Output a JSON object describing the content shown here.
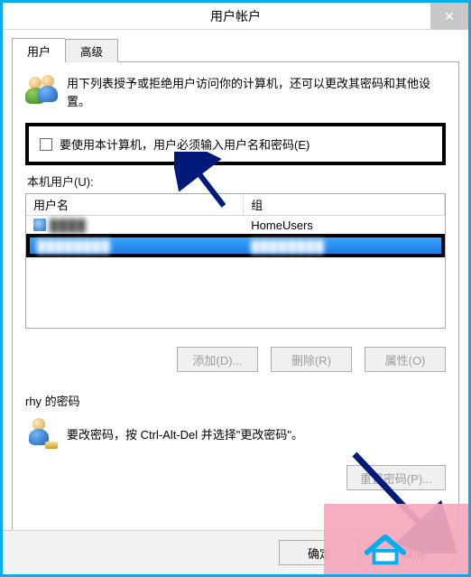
{
  "window": {
    "title": "用户帐户",
    "close_glyph": "✕"
  },
  "tabs": {
    "user": "用户",
    "advanced": "高级"
  },
  "intro": {
    "text": "用下列表授予或拒绝用户访问你的计算机，还可以更改其密码和其他设置。"
  },
  "checkbox": {
    "label": "要使用本计算机，用户必须输入用户名和密码(E)"
  },
  "users_group_label": "本机用户(U):",
  "userlist": {
    "col_user": "用户名",
    "col_group": "组",
    "rows": [
      {
        "user_masked": "████",
        "group": "HomeUsers"
      },
      {
        "user_masked": "████████",
        "group_masked": "████████"
      }
    ]
  },
  "buttons": {
    "add": "添加(D)...",
    "delete": "删除(R)",
    "properties": "属性(O)",
    "reset_pw": "重置密码(P)...",
    "ok": "确定",
    "cancel": "取消"
  },
  "password_section": {
    "label": "rhy 的密码",
    "hint": "要改密码，按 Ctrl-Alt-Del 并选择\"更改密码\"。"
  },
  "colors": {
    "frame": "#00aeef",
    "highlight_row": "#1e7de0",
    "overlay_pink": "#f5a8bc",
    "annotation_arrow": "#001a7a"
  }
}
